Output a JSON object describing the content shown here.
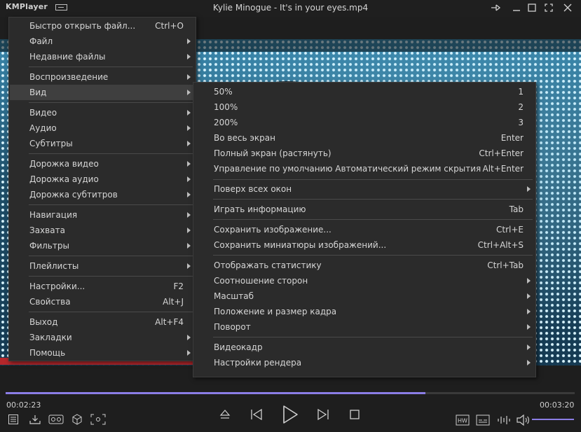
{
  "app": {
    "logo": "KMPlayer",
    "window_title": "Kylie Minogue - It's in your eyes.mp4"
  },
  "colors": {
    "accent": "#8b7ee6",
    "menu_bg": "#2b2b2b",
    "menu_highlight": "#3f3f3f",
    "window_bg": "#1e1e1e"
  },
  "main_menu": {
    "items": [
      {
        "label": "Быстро открыть файл...",
        "shortcut": "Ctrl+O"
      },
      {
        "label": "Файл",
        "arrow": true
      },
      {
        "label": "Недавние файлы",
        "arrow": true
      },
      {
        "label": "Воспроизведение",
        "arrow": true
      },
      {
        "label": "Вид",
        "arrow": true,
        "highlighted": true
      },
      {
        "label": "Видео",
        "arrow": true
      },
      {
        "label": "Аудио",
        "arrow": true
      },
      {
        "label": "Субтитры",
        "arrow": true
      },
      {
        "label": "Дорожка видео",
        "arrow": true
      },
      {
        "label": "Дорожка аудио",
        "arrow": true
      },
      {
        "label": "Дорожка субтитров",
        "arrow": true
      },
      {
        "label": "Навигация",
        "arrow": true
      },
      {
        "label": "Захвата",
        "arrow": true
      },
      {
        "label": "Фильтры",
        "arrow": true
      },
      {
        "label": "Плейлисты",
        "arrow": true
      },
      {
        "label": "Настройки...",
        "shortcut": "F2"
      },
      {
        "label": "Свойства",
        "shortcut": "Alt+J"
      },
      {
        "label": "Выход",
        "shortcut": "Alt+F4"
      },
      {
        "label": "Закладки",
        "arrow": true
      },
      {
        "label": "Помощь",
        "arrow": true
      }
    ]
  },
  "view_submenu": {
    "items": [
      {
        "label": "50%",
        "shortcut": "1"
      },
      {
        "label": "100%",
        "shortcut": "2"
      },
      {
        "label": "200%",
        "shortcut": "3"
      },
      {
        "label": "Во весь экран",
        "shortcut": "Enter"
      },
      {
        "label": "Полный экран (растянуть)",
        "shortcut": "Ctrl+Enter"
      },
      {
        "label": "Управление по умолчанию Автоматический режим скрытия",
        "shortcut": "Alt+Enter"
      },
      {
        "label": "Поверх всех окон",
        "arrow": true
      },
      {
        "label": "Играть информацию",
        "shortcut": "Tab"
      },
      {
        "label": "Сохранить изображение...",
        "shortcut": "Ctrl+E"
      },
      {
        "label": "Сохранить миниатюры изображений...",
        "shortcut": "Ctrl+Alt+S"
      },
      {
        "label": "Отображать статистику",
        "shortcut": "Ctrl+Tab"
      },
      {
        "label": "Соотношение сторон",
        "arrow": true
      },
      {
        "label": "Масштаб",
        "arrow": true
      },
      {
        "label": "Положение и размер кадра",
        "arrow": true
      },
      {
        "label": "Поворот",
        "arrow": true
      },
      {
        "label": "Видеокадр",
        "arrow": true
      },
      {
        "label": "Настройки рендера",
        "arrow": true
      }
    ]
  },
  "player": {
    "current_time": "00:02:23",
    "total_time": "00:03:20",
    "progress": 0.738,
    "volume": 1.0
  }
}
